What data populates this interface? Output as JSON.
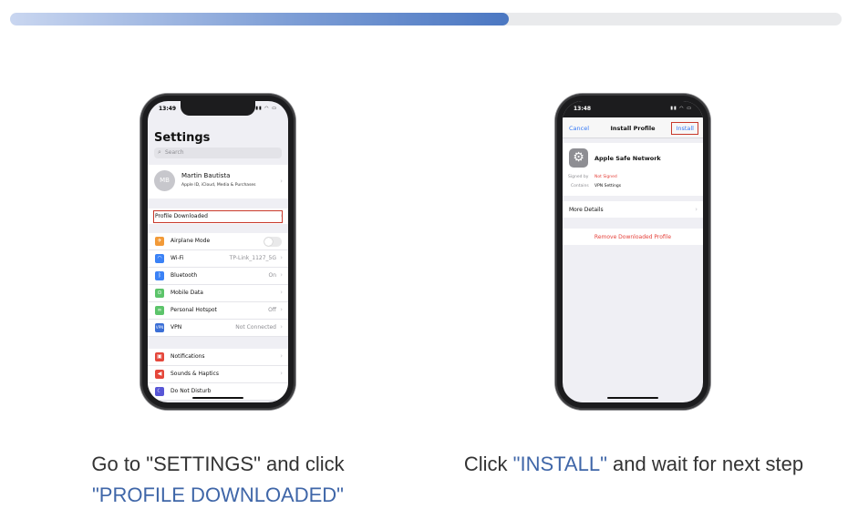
{
  "progress": {
    "fraction": 0.6
  },
  "colors": {
    "accent_blue": "#3f66a8",
    "progress": "#7f9fd6",
    "highlight_red": "#c8392b"
  },
  "left_phone": {
    "status_time": "13:49",
    "title": "Settings",
    "search_placeholder": "Search",
    "profile": {
      "initials": "MB",
      "name": "Martin Bautista",
      "subtitle": "Apple ID, iCloud, Media & Purchases"
    },
    "profile_downloaded": "Profile Downloaded",
    "rows": [
      {
        "icon": "airplane-icon",
        "label": "Airplane Mode",
        "value": "",
        "color": "#f29a38"
      },
      {
        "icon": "wifi-icon",
        "label": "Wi-Fi",
        "value": "TP-Link_1127_5G",
        "color": "#3b82f6"
      },
      {
        "icon": "bluetooth-icon",
        "label": "Bluetooth",
        "value": "On",
        "color": "#3b82f6"
      },
      {
        "icon": "antenna-icon",
        "label": "Mobile Data",
        "value": "",
        "color": "#5cc46a"
      },
      {
        "icon": "hotspot-icon",
        "label": "Personal Hotspot",
        "value": "Off",
        "color": "#5cc46a"
      },
      {
        "icon": "vpn-icon",
        "label": "VPN",
        "value": "Not Connected",
        "color": "#3b6fd6"
      }
    ],
    "rows2": [
      {
        "icon": "notifications-icon",
        "label": "Notifications",
        "color": "#e5473b"
      },
      {
        "icon": "sounds-icon",
        "label": "Sounds & Haptics",
        "color": "#e5473b"
      },
      {
        "icon": "moon-icon",
        "label": "Do Not Disturb",
        "color": "#5856d6"
      }
    ]
  },
  "right_phone": {
    "status_time": "13:48",
    "nav_cancel": "Cancel",
    "nav_title": "Install Profile",
    "nav_install": "Install",
    "profile_name": "Apple Safe Network",
    "signed_by_label": "Signed by",
    "signed_by_value": "Not Signed",
    "contains_label": "Contains",
    "contains_value": "VPN Settings",
    "more_details": "More Details",
    "remove": "Remove Downloaded Profile"
  },
  "captions": {
    "left_line1": "Go to \"SETTINGS\" and click",
    "left_line2": "\"PROFILE DOWNLOADED\"",
    "right_pre": "Click ",
    "right_highlight": "\"INSTALL\"",
    "right_post": " and wait for next step"
  }
}
